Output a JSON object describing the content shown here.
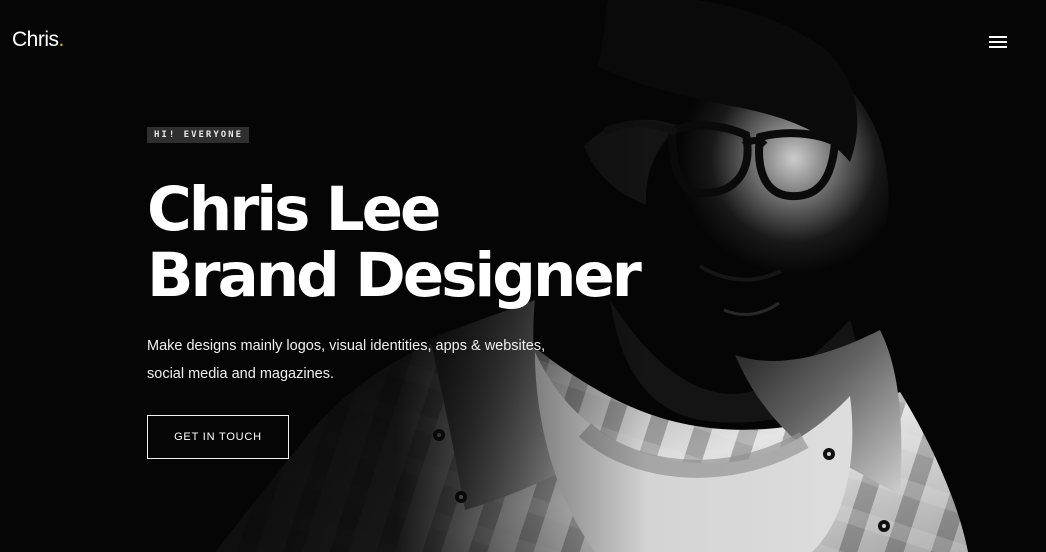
{
  "brand": {
    "name": "Chris",
    "dot": ".",
    "accent_color": "#f5b400"
  },
  "navigation": {
    "menu_icon": "hamburger-menu-icon"
  },
  "hero": {
    "eyebrow": "HI! EVERYONE",
    "title_line_1": "Chris Lee",
    "title_line_2": "Brand Designer",
    "description_line_1": "Make designs mainly logos, visual identities, apps & websites,",
    "description_line_2": "social media and magazines.",
    "cta_label": "GET IN TOUCH",
    "background_color": "#050505",
    "text_color": "#ffffff"
  },
  "image": {
    "subject": "black-and-white portrait",
    "alt": "portrait photo"
  }
}
